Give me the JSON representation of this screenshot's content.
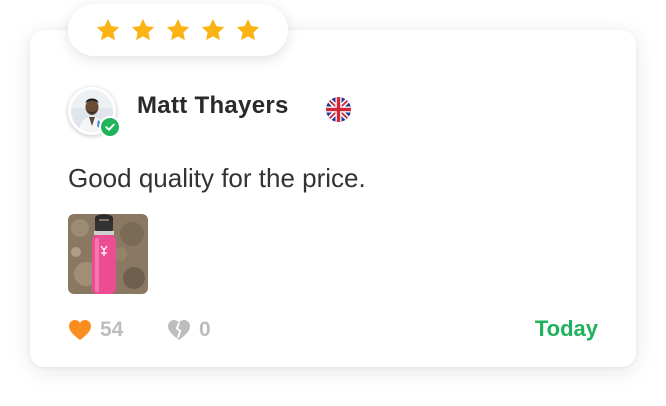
{
  "review": {
    "rating": 5,
    "rating_max": 5,
    "reviewer_name": "Matt Thayers",
    "verified": true,
    "country_flag_icon": "uk-flag-icon",
    "text": "Good quality for the price.",
    "photo_icon": "pink-water-bottle-photo",
    "likes": "54",
    "dislikes": "0",
    "date": "Today"
  },
  "colors": {
    "star": "#fbb313",
    "verified": "#22b45b",
    "like_heart": "#fb8c1f",
    "dislike_heart": "#bdbdbd",
    "date": "#1fb15c",
    "name": "#2a2a2a"
  }
}
